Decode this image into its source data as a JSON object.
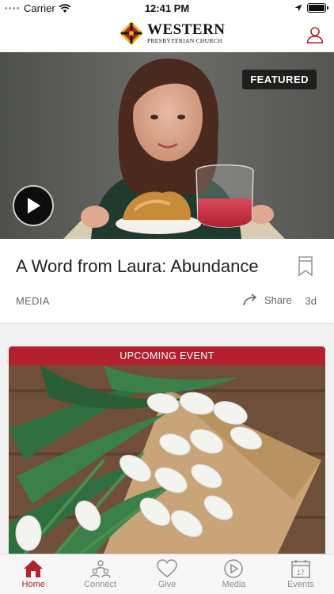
{
  "status_bar": {
    "carrier": "Carrier",
    "time": "12:41 PM"
  },
  "header": {
    "logo_title": "WESTERN",
    "logo_subtitle": "PRESBYTERIAN CHURCH"
  },
  "featured_card": {
    "badge": "FEATURED",
    "title": "A Word from Laura: Abundance",
    "category": "MEDIA",
    "share_label": "Share",
    "age": "3d"
  },
  "event_card": {
    "banner": "UPCOMING EVENT"
  },
  "tab_bar": {
    "tabs": [
      {
        "label": "Home",
        "icon": "home-icon",
        "active": true
      },
      {
        "label": "Connect",
        "icon": "connect-icon",
        "active": false
      },
      {
        "label": "Give",
        "icon": "heart-icon",
        "active": false
      },
      {
        "label": "Media",
        "icon": "play-circle-icon",
        "active": false
      },
      {
        "label": "Events",
        "icon": "calendar-icon",
        "active": false,
        "calendar_day": "17"
      }
    ]
  },
  "colors": {
    "accent": "#b3202e",
    "inactive": "#8e8e93",
    "logo_red": "#b3202e",
    "logo_yellow": "#e5b31a"
  }
}
